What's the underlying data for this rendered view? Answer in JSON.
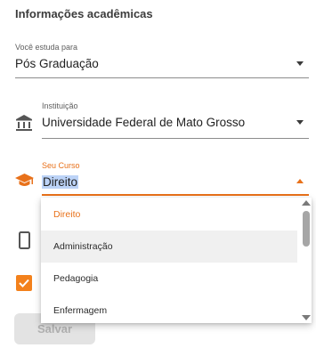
{
  "section_title": "Informações acadêmicas",
  "study_field": {
    "label": "Você estuda para",
    "value": "Pós Graduação"
  },
  "institution_field": {
    "label": "Instituição",
    "value": "Universidade Federal de Mato Grosso"
  },
  "course_field": {
    "label": "Seu Curso",
    "value": "Direito"
  },
  "dropdown": {
    "options": [
      "Direito",
      "Administração",
      "Pedagogia",
      "Enfermagem"
    ],
    "selected": "Direito",
    "hovered": "Administração"
  },
  "save_button": {
    "label": "Salvar"
  },
  "colors": {
    "accent": "#e8711a",
    "checkbox": "#f3811c",
    "selection": "#bcd3f7"
  },
  "icons": [
    "bank-icon",
    "graduation-cap-icon",
    "smartphone-icon",
    "checkbox-checked-icon"
  ]
}
